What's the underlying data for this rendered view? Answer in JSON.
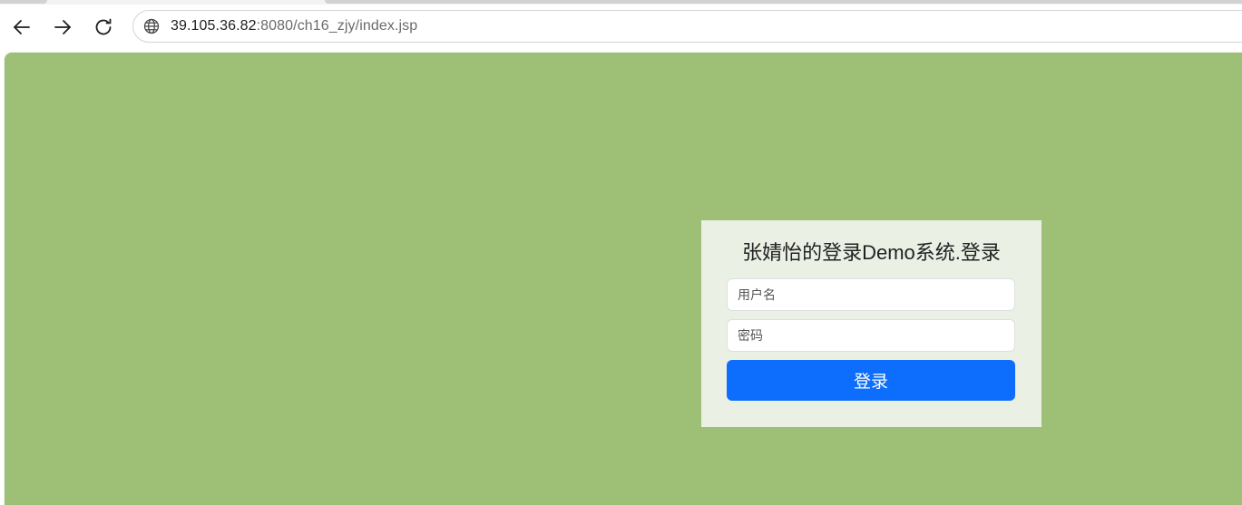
{
  "browser": {
    "url_host": "39.105.36.82",
    "url_rest": ":8080/ch16_zjy/index.jsp",
    "icons": {
      "back": "arrow-left-icon",
      "forward": "arrow-right-icon",
      "reload": "reload-icon",
      "site": "globe-icon"
    }
  },
  "login": {
    "title": "张婧怡的登录Demo系统.登录",
    "username_placeholder": "用户名",
    "password_placeholder": "密码",
    "submit_label": "登录"
  },
  "colors": {
    "page_background": "#9dc076",
    "panel_background": "#ebf0e5",
    "button_primary": "#0d6efd"
  }
}
